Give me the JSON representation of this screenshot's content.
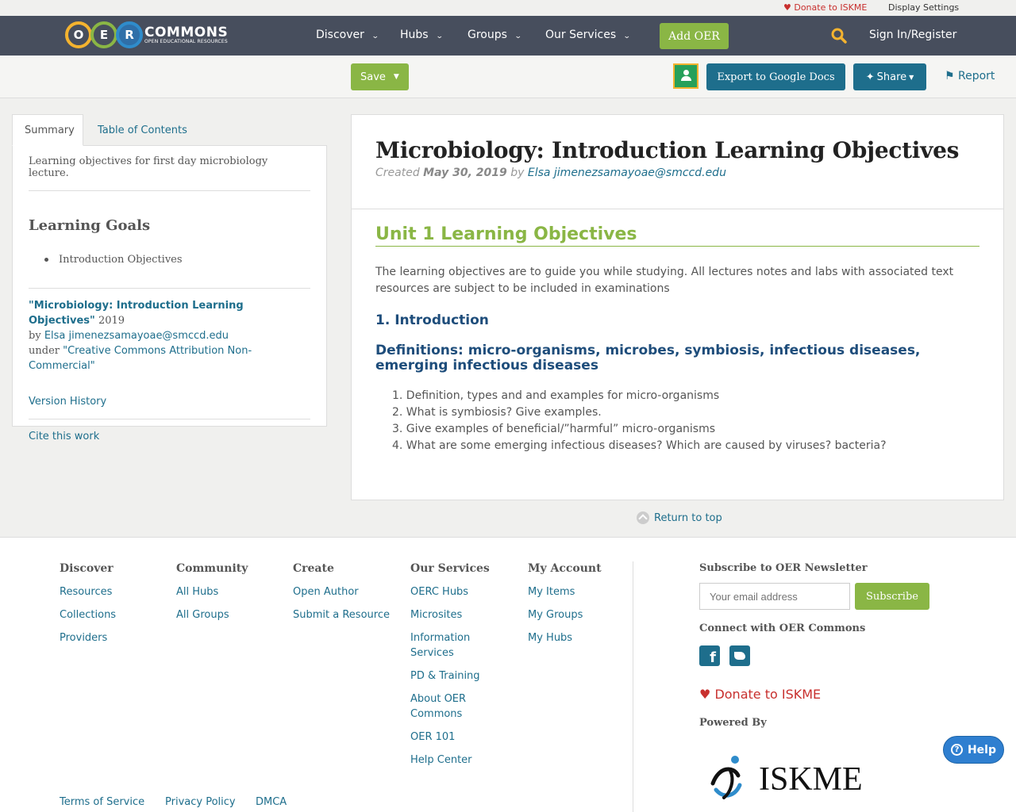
{
  "topbar": {
    "donate": "Donate to ISKME",
    "display_settings": "Display Settings"
  },
  "logo": {
    "letters": [
      "O",
      "E",
      "R"
    ],
    "name": "COMMONS",
    "tagline": "OPEN EDUCATIONAL RESOURCES"
  },
  "nav": {
    "items": [
      "Discover",
      "Hubs",
      "Groups",
      "Our Services"
    ],
    "add_oer": "Add OER",
    "sign_in": "Sign In/Register"
  },
  "toolbar": {
    "save": "Save",
    "export": "Export to Google Docs",
    "share": "Share",
    "report": "Report"
  },
  "sidebar": {
    "tabs": [
      "Summary",
      "Table of Contents"
    ],
    "description": "Learning objectives for first day microbiology lecture.",
    "goals_heading": "Learning Goals",
    "goals": [
      "Introduction Objectives"
    ],
    "attribution": {
      "title": "\"Microbiology: Introduction Learning Objectives\"",
      "year": "2019",
      "by": "by",
      "author": "Elsa jimenezsamayoae@smccd.edu",
      "under": "under",
      "license": "\"Creative Commons Attribution Non-Commercial\""
    },
    "version_history": "Version History",
    "cite": "Cite this work"
  },
  "main": {
    "title": "Microbiology: Introduction Learning Objectives",
    "created_label": "Created",
    "created_date": "May 30, 2019",
    "by_label": "by",
    "author": "Elsa jimenezsamayoae@smccd.edu",
    "unit_title": "Unit 1 Learning Objectives",
    "intro": "The learning objectives are to guide you while studying. All lectures notes and labs with associated text resources are subject to be included in examinations",
    "section_heading": "1. Introduction",
    "definitions_heading": "Definitions: micro-organisms, microbes, symbiosis, infectious diseases, emerging infectious diseases",
    "questions": [
      "1.  Definition, types and and examples for micro-organisms",
      "2. What is symbiosis? Give examples.",
      "3.  Give examples of beneficial/”harmful” micro-organisms",
      "4. What are some emerging infectious diseases? Which are caused by viruses? bacteria?"
    ]
  },
  "return_top": "Return to top",
  "footer": {
    "columns": [
      {
        "heading": "Discover",
        "links": [
          "Resources",
          "Collections",
          "Providers"
        ]
      },
      {
        "heading": "Community",
        "links": [
          "All Hubs",
          "All Groups"
        ]
      },
      {
        "heading": "Create",
        "links": [
          "Open Author",
          "Submit a Resource"
        ]
      },
      {
        "heading": "Our Services",
        "links": [
          "OERC Hubs",
          "Microsites",
          "Information Services",
          "PD & Training",
          "About OER Commons",
          "OER 101",
          "Help Center"
        ]
      },
      {
        "heading": "My Account",
        "links": [
          "My Items",
          "My Groups",
          "My Hubs"
        ]
      }
    ],
    "newsletter_heading": "Subscribe to OER Newsletter",
    "email_placeholder": "Your email address",
    "subscribe": "Subscribe",
    "connect_heading": "Connect with OER Commons",
    "donate": "Donate to ISKME",
    "powered_by": "Powered By",
    "iskme_logo_text": "ISKME",
    "legal_links": [
      "Terms of Service",
      "Privacy Policy",
      "DMCA"
    ]
  },
  "help": "Help",
  "colors": {
    "nav_bg": "#474e5d",
    "green": "#8ab645",
    "teal": "#1e6e8c",
    "red": "#c8302e",
    "heading_blue": "#1e4d7b"
  }
}
